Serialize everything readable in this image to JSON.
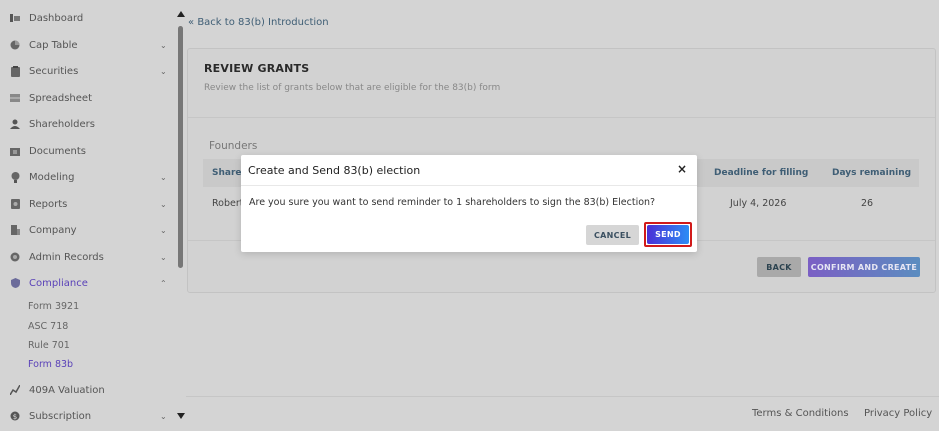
{
  "sidebar": {
    "items": [
      {
        "label": "Dashboard",
        "icon": "dashboard-icon"
      },
      {
        "label": "Cap Table",
        "icon": "pie-chart-icon"
      },
      {
        "label": "Securities",
        "icon": "clipboard-icon"
      },
      {
        "label": "Spreadsheet",
        "icon": "table-icon"
      },
      {
        "label": "Shareholders",
        "icon": "user-icon"
      },
      {
        "label": "Documents",
        "icon": "folder-icon"
      },
      {
        "label": "Modeling",
        "icon": "lightbulb-icon"
      },
      {
        "label": "Reports",
        "icon": "report-icon"
      },
      {
        "label": "Company",
        "icon": "building-icon"
      },
      {
        "label": "Admin Records",
        "icon": "records-icon"
      },
      {
        "label": "Compliance",
        "icon": "shield-icon"
      },
      {
        "label": "409A Valuation",
        "icon": "valuation-icon"
      },
      {
        "label": "Subscription",
        "icon": "dollar-icon"
      }
    ],
    "compliance_sub": [
      "Form 3921",
      "ASC 718",
      "Rule 701",
      "Form 83b"
    ]
  },
  "back_link": "Back to 83(b) Introduction",
  "review": {
    "title": "REVIEW GRANTS",
    "subtitle": "Review the list of grants below that are eligible for the 83(b) form"
  },
  "founders_label": "Founders",
  "table": {
    "col_shareholder": "Shareh",
    "col_deadline": "Deadline for filling",
    "col_days": "Days remaining",
    "row_name": "Robert",
    "row_deadline": "July 4, 2026",
    "row_days": "26"
  },
  "buttons": {
    "back": "BACK",
    "confirm": "CONFIRM AND CREATE"
  },
  "footer": {
    "terms": "Terms & Conditions",
    "privacy": "Privacy Policy"
  },
  "modal": {
    "title": "Create and Send 83(b) election",
    "close": "×",
    "message": "Are you sure you want to send reminder to 1 shareholders to sign the 83(b) Election?",
    "cancel": "CANCEL",
    "send": "SEND"
  },
  "colors": {
    "accent": "#5a42b8",
    "link": "#3f5e75",
    "highlight": "#d11a1a"
  }
}
